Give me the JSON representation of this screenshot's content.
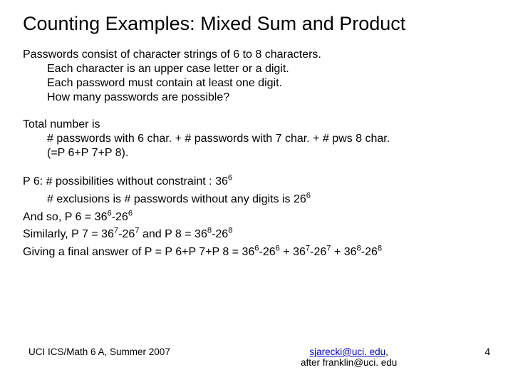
{
  "title": "Counting Examples: Mixed Sum and Product",
  "p1": {
    "l1": "Passwords consist of character strings of 6 to 8 characters.",
    "l2": "Each character is an upper case letter or a digit.",
    "l3": "Each password must contain at least one digit.",
    "l4": "How many passwords are possible?"
  },
  "p2": {
    "l1": "Total number is",
    "l2": "# passwords with 6 char. + # passwords with 7 char. + # pws 8 char.",
    "l3": "(=P 6+P 7+P 8)."
  },
  "p3": {
    "a1": "P 6: # possibilities without constraint : 36",
    "a1s": "6",
    "b1": "# exclusions is # passwords without any digits is 26",
    "b1s": "6",
    "c1": "And so, P 6 = 36",
    "c1s": "6",
    "c2": "-26",
    "c2s": "6",
    "d1": "Similarly, P 7 = 36",
    "d1s": "7",
    "d2": "-26",
    "d2s": "7",
    "d3": " and P 8 = 36",
    "d3s": "8",
    "d4": "-26",
    "d4s": "8",
    "e1": "Giving a final answer of P = P 6+P 7+P 8 = 36",
    "e1s": "6",
    "e2": "-26",
    "e2s": "6",
    "e3": " + 36",
    "e3s": "7",
    "e4": "-26",
    "e4s": "7",
    "e5": " + 36",
    "e5s": "8",
    "e6": "-26",
    "e6s": "8"
  },
  "footer": {
    "left": "UCI ICS/Math 6 A, Summer 2007",
    "email": "sjarecki@uci. edu",
    "comma": ",",
    "after": "after franklin@uci. edu",
    "page": "4"
  }
}
